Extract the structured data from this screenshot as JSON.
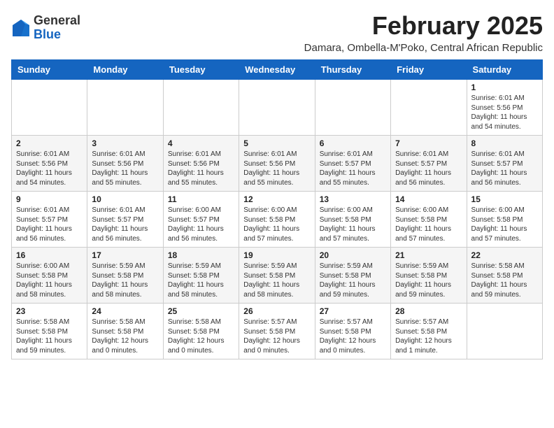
{
  "header": {
    "logo_line1": "General",
    "logo_line2": "Blue",
    "title": "February 2025",
    "subtitle": "Damara, Ombella-M'Poko, Central African Republic"
  },
  "weekdays": [
    "Sunday",
    "Monday",
    "Tuesday",
    "Wednesday",
    "Thursday",
    "Friday",
    "Saturday"
  ],
  "weeks": [
    [
      {
        "day": "",
        "info": ""
      },
      {
        "day": "",
        "info": ""
      },
      {
        "day": "",
        "info": ""
      },
      {
        "day": "",
        "info": ""
      },
      {
        "day": "",
        "info": ""
      },
      {
        "day": "",
        "info": ""
      },
      {
        "day": "1",
        "info": "Sunrise: 6:01 AM\nSunset: 5:56 PM\nDaylight: 11 hours\nand 54 minutes."
      }
    ],
    [
      {
        "day": "2",
        "info": "Sunrise: 6:01 AM\nSunset: 5:56 PM\nDaylight: 11 hours\nand 54 minutes."
      },
      {
        "day": "3",
        "info": "Sunrise: 6:01 AM\nSunset: 5:56 PM\nDaylight: 11 hours\nand 55 minutes."
      },
      {
        "day": "4",
        "info": "Sunrise: 6:01 AM\nSunset: 5:56 PM\nDaylight: 11 hours\nand 55 minutes."
      },
      {
        "day": "5",
        "info": "Sunrise: 6:01 AM\nSunset: 5:56 PM\nDaylight: 11 hours\nand 55 minutes."
      },
      {
        "day": "6",
        "info": "Sunrise: 6:01 AM\nSunset: 5:57 PM\nDaylight: 11 hours\nand 55 minutes."
      },
      {
        "day": "7",
        "info": "Sunrise: 6:01 AM\nSunset: 5:57 PM\nDaylight: 11 hours\nand 56 minutes."
      },
      {
        "day": "8",
        "info": "Sunrise: 6:01 AM\nSunset: 5:57 PM\nDaylight: 11 hours\nand 56 minutes."
      }
    ],
    [
      {
        "day": "9",
        "info": "Sunrise: 6:01 AM\nSunset: 5:57 PM\nDaylight: 11 hours\nand 56 minutes."
      },
      {
        "day": "10",
        "info": "Sunrise: 6:01 AM\nSunset: 5:57 PM\nDaylight: 11 hours\nand 56 minutes."
      },
      {
        "day": "11",
        "info": "Sunrise: 6:00 AM\nSunset: 5:57 PM\nDaylight: 11 hours\nand 56 minutes."
      },
      {
        "day": "12",
        "info": "Sunrise: 6:00 AM\nSunset: 5:58 PM\nDaylight: 11 hours\nand 57 minutes."
      },
      {
        "day": "13",
        "info": "Sunrise: 6:00 AM\nSunset: 5:58 PM\nDaylight: 11 hours\nand 57 minutes."
      },
      {
        "day": "14",
        "info": "Sunrise: 6:00 AM\nSunset: 5:58 PM\nDaylight: 11 hours\nand 57 minutes."
      },
      {
        "day": "15",
        "info": "Sunrise: 6:00 AM\nSunset: 5:58 PM\nDaylight: 11 hours\nand 57 minutes."
      }
    ],
    [
      {
        "day": "16",
        "info": "Sunrise: 6:00 AM\nSunset: 5:58 PM\nDaylight: 11 hours\nand 58 minutes."
      },
      {
        "day": "17",
        "info": "Sunrise: 5:59 AM\nSunset: 5:58 PM\nDaylight: 11 hours\nand 58 minutes."
      },
      {
        "day": "18",
        "info": "Sunrise: 5:59 AM\nSunset: 5:58 PM\nDaylight: 11 hours\nand 58 minutes."
      },
      {
        "day": "19",
        "info": "Sunrise: 5:59 AM\nSunset: 5:58 PM\nDaylight: 11 hours\nand 58 minutes."
      },
      {
        "day": "20",
        "info": "Sunrise: 5:59 AM\nSunset: 5:58 PM\nDaylight: 11 hours\nand 59 minutes."
      },
      {
        "day": "21",
        "info": "Sunrise: 5:59 AM\nSunset: 5:58 PM\nDaylight: 11 hours\nand 59 minutes."
      },
      {
        "day": "22",
        "info": "Sunrise: 5:58 AM\nSunset: 5:58 PM\nDaylight: 11 hours\nand 59 minutes."
      }
    ],
    [
      {
        "day": "23",
        "info": "Sunrise: 5:58 AM\nSunset: 5:58 PM\nDaylight: 11 hours\nand 59 minutes."
      },
      {
        "day": "24",
        "info": "Sunrise: 5:58 AM\nSunset: 5:58 PM\nDaylight: 12 hours\nand 0 minutes."
      },
      {
        "day": "25",
        "info": "Sunrise: 5:58 AM\nSunset: 5:58 PM\nDaylight: 12 hours\nand 0 minutes."
      },
      {
        "day": "26",
        "info": "Sunrise: 5:57 AM\nSunset: 5:58 PM\nDaylight: 12 hours\nand 0 minutes."
      },
      {
        "day": "27",
        "info": "Sunrise: 5:57 AM\nSunset: 5:58 PM\nDaylight: 12 hours\nand 0 minutes."
      },
      {
        "day": "28",
        "info": "Sunrise: 5:57 AM\nSunset: 5:58 PM\nDaylight: 12 hours\nand 1 minute."
      },
      {
        "day": "",
        "info": ""
      }
    ]
  ]
}
